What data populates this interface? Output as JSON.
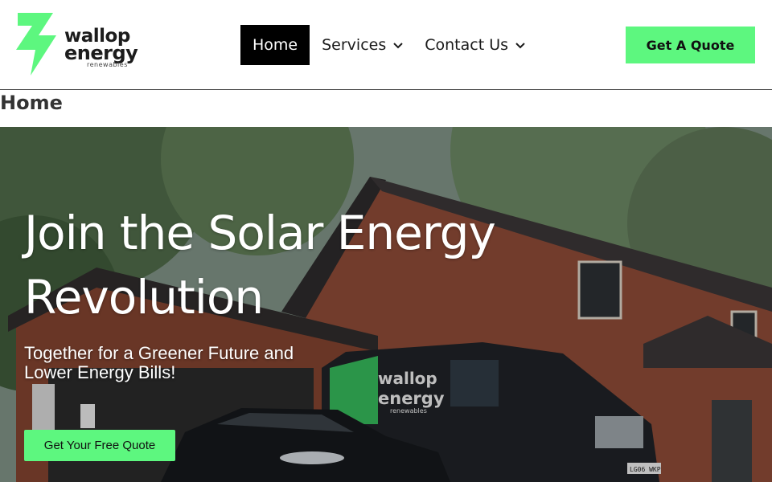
{
  "brand": {
    "word1": "wallop",
    "word2": "energy",
    "sub": "renewables",
    "accent_color": "#5df77f"
  },
  "nav": {
    "items": [
      {
        "label": "Home",
        "active": true
      },
      {
        "label": "Services",
        "icon": "chevron-down-icon"
      },
      {
        "label": "Contact Us",
        "icon": "chevron-down-icon"
      }
    ]
  },
  "header": {
    "cta_label": "Get A Quote"
  },
  "page": {
    "title": "Home"
  },
  "hero": {
    "title": "Join the Solar Energy Revolution",
    "subtitle": "Together for a Greener Future and Lower Energy Bills!",
    "cta_label": "Get Your Free Quote",
    "van_word1": "wallop",
    "van_word2": "energy",
    "van_sub": "renewables",
    "plate": "LG06 WKP"
  }
}
